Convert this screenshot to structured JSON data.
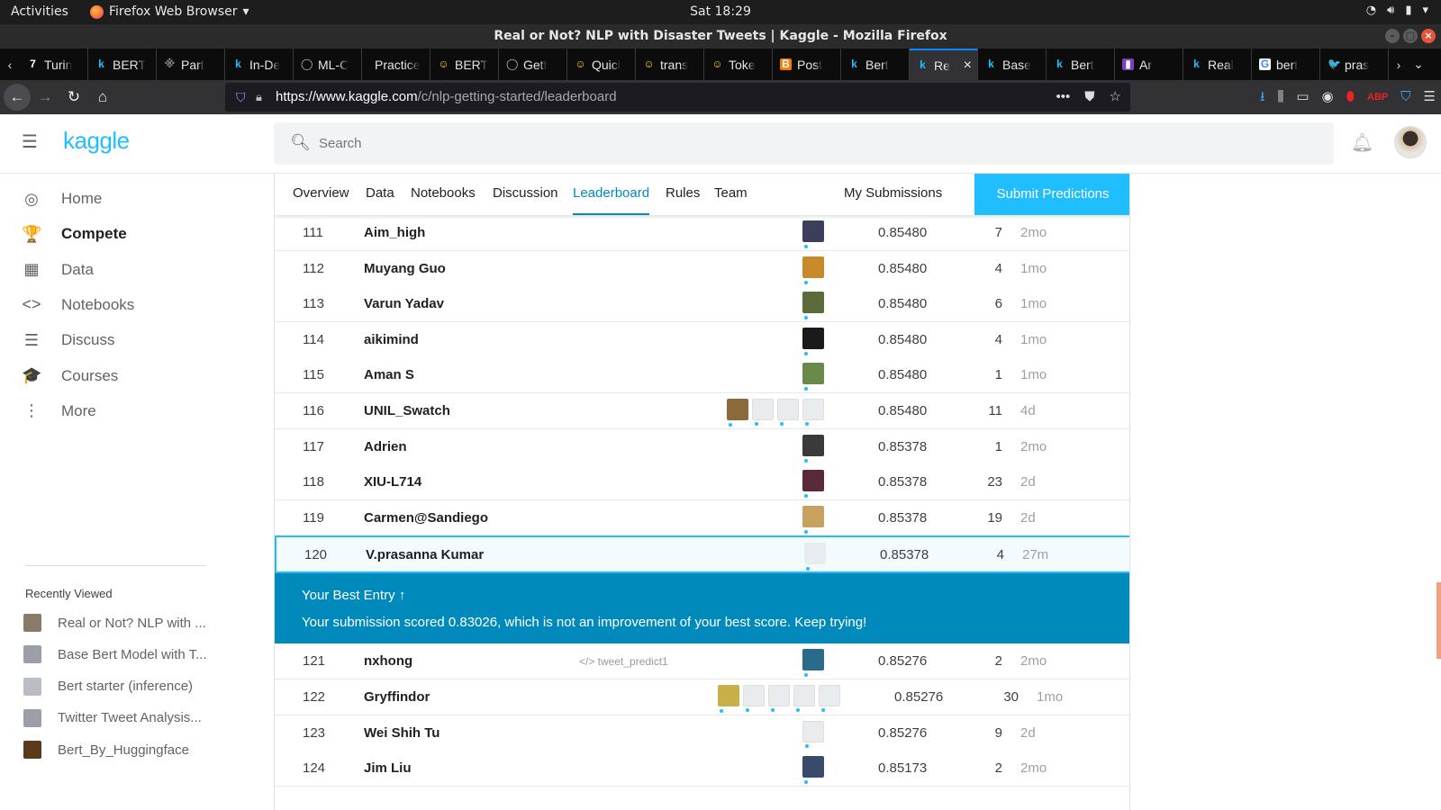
{
  "os": {
    "activities": "Activities",
    "app_name": "Firefox Web Browser",
    "app_menu_arrow": "▾",
    "clock": "Sat 18:29",
    "tray_icons": [
      "wifi-icon",
      "volume-icon",
      "battery-icon",
      "chevron-down-icon"
    ]
  },
  "window": {
    "title": "Real or Not? NLP with Disaster Tweets | Kaggle - Mozilla Firefox"
  },
  "tabs": [
    {
      "label": "Turin",
      "fav": "7",
      "fav_color": "#ffffff",
      "fav_bg": "transparent"
    },
    {
      "label": "BERT",
      "fav": "k",
      "fav_color": "#20beff",
      "fav_bg": "transparent"
    },
    {
      "label": "Part",
      "fav": "※",
      "fav_color": "#888888",
      "fav_bg": "transparent"
    },
    {
      "label": "In-De",
      "fav": "k",
      "fav_color": "#20beff",
      "fav_bg": "transparent"
    },
    {
      "label": "ML-C",
      "fav": "◯",
      "fav_color": "#bbbbbb",
      "fav_bg": "transparent"
    },
    {
      "label": "Practice",
      "fav": "",
      "fav_color": "#ffffff",
      "fav_bg": "transparent"
    },
    {
      "label": "BERT",
      "fav": "☺",
      "fav_color": "#ffd21e",
      "fav_bg": "transparent"
    },
    {
      "label": "Gett",
      "fav": "◯",
      "fav_color": "#bbbbbb",
      "fav_bg": "transparent"
    },
    {
      "label": "Quicl",
      "fav": "☺",
      "fav_color": "#ffd21e",
      "fav_bg": "transparent"
    },
    {
      "label": "trans",
      "fav": "☺",
      "fav_color": "#ffd21e",
      "fav_bg": "transparent"
    },
    {
      "label": "Toke",
      "fav": "☺",
      "fav_color": "#ffd21e",
      "fav_bg": "transparent"
    },
    {
      "label": "Post",
      "fav": "B",
      "fav_color": "#ffffff",
      "fav_bg": "#f57d00"
    },
    {
      "label": "Bert",
      "fav": "k",
      "fav_color": "#20beff",
      "fav_bg": "transparent"
    },
    {
      "label": "Re",
      "fav": "k",
      "fav_color": "#20beff",
      "fav_bg": "transparent",
      "active": true
    },
    {
      "label": "Base",
      "fav": "k",
      "fav_color": "#20beff",
      "fav_bg": "transparent"
    },
    {
      "label": "Bert",
      "fav": "k",
      "fav_color": "#20beff",
      "fav_bg": "transparent"
    },
    {
      "label": "Ar",
      "fav": "▮",
      "fav_color": "#ffffff",
      "fav_bg": "#7b3fbf"
    },
    {
      "label": "Real",
      "fav": "k",
      "fav_color": "#20beff",
      "fav_bg": "transparent"
    },
    {
      "label": "bert",
      "fav": "G",
      "fav_color": "#4285f4",
      "fav_bg": "#ffffff"
    },
    {
      "label": "pras",
      "fav": "🐦",
      "fav_color": "#1da1f2",
      "fav_bg": "transparent"
    }
  ],
  "nav": {
    "url_host": "https://www.kaggle.com",
    "url_path": "/c/nlp-getting-started/leaderboard",
    "toolbar_icons": [
      "download-icon",
      "library-icon",
      "sidebar-icon",
      "account-icon",
      "extension-icon",
      "adblock-icon",
      "privacy-badger-icon",
      "hamburger-menu-icon"
    ]
  },
  "kaggle": {
    "logo": "kaggle",
    "search_placeholder": "Search",
    "sidebar": [
      {
        "label": "Home",
        "icon": "compass-icon",
        "glyph": "◎"
      },
      {
        "label": "Compete",
        "icon": "trophy-icon",
        "glyph": "🏆",
        "active": true
      },
      {
        "label": "Data",
        "icon": "table-icon",
        "glyph": "▦"
      },
      {
        "label": "Notebooks",
        "icon": "code-icon",
        "glyph": "<>"
      },
      {
        "label": "Discuss",
        "icon": "comment-icon",
        "glyph": "☰"
      },
      {
        "label": "Courses",
        "icon": "graduation-cap-icon",
        "glyph": "🎓"
      },
      {
        "label": "More",
        "icon": "more-vert-icon",
        "glyph": "⋮"
      }
    ],
    "recently_viewed_title": "Recently Viewed",
    "recently_viewed": [
      {
        "label": "Real or Not? NLP with ..."
      },
      {
        "label": "Base Bert Model with T..."
      },
      {
        "label": "Bert starter (inference)"
      },
      {
        "label": "Twitter Tweet Analysis..."
      },
      {
        "label": "Bert_By_Huggingface"
      }
    ],
    "content_tabs": [
      "Overview",
      "Data",
      "Notebooks",
      "Discussion",
      "Leaderboard",
      "Rules",
      "Team"
    ],
    "active_tab": "Leaderboard",
    "my_submissions": "My Submissions",
    "submit_predictions": "Submit Predictions",
    "leaderboard": [
      {
        "rank": "111",
        "team": "Aim_high",
        "kernel": "",
        "members": 1,
        "score": "0.85480",
        "entries": "7",
        "last": "2mo"
      },
      {
        "rank": "112",
        "team": "Muyang Guo",
        "kernel": "",
        "members": 1,
        "score": "0.85480",
        "entries": "4",
        "last": "1mo"
      },
      {
        "rank": "113",
        "team": "Varun Yadav",
        "kernel": "",
        "members": 1,
        "score": "0.85480",
        "entries": "6",
        "last": "1mo"
      },
      {
        "rank": "114",
        "team": "aikimind",
        "kernel": "",
        "members": 1,
        "score": "0.85480",
        "entries": "4",
        "last": "1mo"
      },
      {
        "rank": "115",
        "team": "Aman S",
        "kernel": "",
        "members": 1,
        "score": "0.85480",
        "entries": "1",
        "last": "1mo"
      },
      {
        "rank": "116",
        "team": "UNIL_Swatch",
        "kernel": "",
        "members": 4,
        "score": "0.85480",
        "entries": "11",
        "last": "4d"
      },
      {
        "rank": "117",
        "team": "Adrien",
        "kernel": "",
        "members": 1,
        "score": "0.85378",
        "entries": "1",
        "last": "2mo"
      },
      {
        "rank": "118",
        "team": "XIU-L714",
        "kernel": "",
        "members": 1,
        "score": "0.85378",
        "entries": "23",
        "last": "2d"
      },
      {
        "rank": "119",
        "team": "Carmen@Sandiego",
        "kernel": "",
        "members": 1,
        "score": "0.85378",
        "entries": "19",
        "last": "2d"
      },
      {
        "rank": "120",
        "team": "V.prasanna Kumar",
        "kernel": "",
        "members": 1,
        "score": "0.85378",
        "entries": "4",
        "last": "27m",
        "highlight": true
      },
      {
        "rank": "121",
        "team": "nxhong",
        "kernel": "</> tweet_predict1",
        "members": 1,
        "score": "0.85276",
        "entries": "2",
        "last": "2mo"
      },
      {
        "rank": "122",
        "team": "Gryffindor",
        "kernel": "",
        "members": 5,
        "score": "0.85276",
        "entries": "30",
        "last": "1mo"
      },
      {
        "rank": "123",
        "team": "Wei Shih Tu",
        "kernel": "",
        "members": 1,
        "score": "0.85276",
        "entries": "9",
        "last": "2d"
      },
      {
        "rank": "124",
        "team": "Jim Liu",
        "kernel": "",
        "members": 1,
        "score": "0.85173",
        "entries": "2",
        "last": "2mo"
      }
    ],
    "best_entry": {
      "title": "Your Best Entry ↑",
      "message": "Your submission scored 0.83026, which is not an improvement of your best score. Keep trying!"
    }
  },
  "colors": {
    "accent": "#20beff",
    "banner": "#008abc"
  }
}
